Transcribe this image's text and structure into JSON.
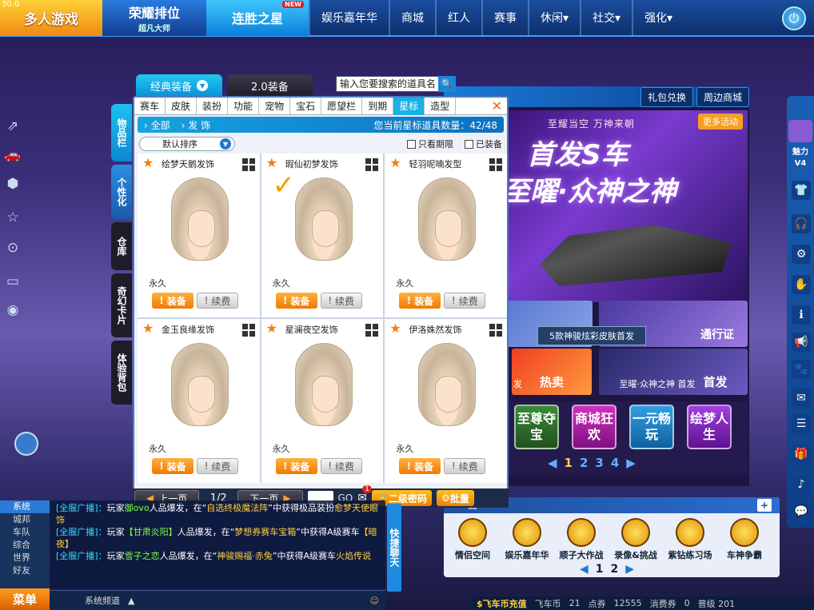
{
  "fps": "30.0",
  "nav": {
    "multi": "多人游戏",
    "rank_title": "荣耀排位",
    "rank_sub": "超凡大师",
    "streak": "连胜之星",
    "new_badge": "NEW",
    "items": [
      "娱乐嘉年华",
      "商城",
      "红人",
      "赛事",
      "休闲▾",
      "社交▾",
      "强化▾"
    ]
  },
  "panel_tabs": [
    "经典装备",
    "2.0装备"
  ],
  "search": {
    "placeholder": "输入您要搜索的道具名"
  },
  "categories": [
    "赛车",
    "皮肤",
    "装扮",
    "功能",
    "宠物",
    "宝石",
    "愿望栏",
    "到期",
    "星标",
    "造型"
  ],
  "active_category": "星标",
  "breadcrumb": {
    "all": "全部",
    "sub": "发 饰",
    "count_label": "您当前星标道具数量：42/48"
  },
  "sort": {
    "label": "默认排序",
    "filter1": "只看期限",
    "filter2": "已装备"
  },
  "items": [
    {
      "name": "绘梦天鹅发饰",
      "duration": "永久",
      "equip": "装备",
      "renew": "续费"
    },
    {
      "name": "瑕仙初梦发饰",
      "duration": "永久",
      "equip": "装备",
      "renew": "续费"
    },
    {
      "name": "轻羽呢喃发型",
      "duration": "永久",
      "equip": "装备",
      "renew": "续费"
    },
    {
      "name": "金玉良缘发饰",
      "duration": "永久",
      "equip": "装备",
      "renew": "续费"
    },
    {
      "name": "星澜夜空发饰",
      "duration": "永久",
      "equip": "装备",
      "renew": "续费"
    },
    {
      "name": "伊洛姝然发饰",
      "duration": "永久",
      "equip": "装备",
      "renew": "续费"
    }
  ],
  "side_tabs": [
    "物品栏",
    "个性化",
    "仓库",
    "奇幻卡片",
    "体验背包"
  ],
  "pager": {
    "prev": "上一页",
    "page": "1/2",
    "next": "下一页",
    "go": "GO",
    "password": "二级密码",
    "batch": "批量",
    "mail_count": "1"
  },
  "promo": {
    "gift_exchange": "礼包兑换",
    "nearby_shop": "周边商城",
    "banner_sub": "至耀当空 万神来朝",
    "banner_title": "首发S车",
    "banner_title2": "至曜·众神之神",
    "more": "更多活动",
    "pass": "通行证",
    "tooltip": "5款神骏炫彩皮肤首发",
    "hot": "热卖",
    "hot_left": "发",
    "car_caption": "至曜·众神之神 首发",
    "first": "首发",
    "squares": [
      "至尊夺宝",
      "商城狂欢",
      "一元畅玩",
      "绘梦人生"
    ],
    "pages": [
      "1",
      "2",
      "3",
      "4"
    ]
  },
  "quick": {
    "title": "面",
    "items": [
      "情侣空间",
      "娱乐嘉年华",
      "顺子大作战",
      "录像&挑战",
      "紫钻练习场",
      "车神争霸"
    ],
    "pages": [
      "1",
      "2"
    ]
  },
  "chat": {
    "tabs": [
      "系统",
      "城邦",
      "车队",
      "综合",
      "世界",
      "好友"
    ],
    "lines": [
      [
        "[全服广播]：",
        "玩家",
        "御ovo",
        "人品爆发，在“",
        "自选终极魔法阵",
        "”中获得极品装扮",
        "愈梦天使眼饰"
      ],
      [
        "[全服广播]：",
        "玩家",
        "【甘肃炎阳】",
        "人品爆发，在“",
        "梦想券赛车宝箱",
        "”中获得A级赛车",
        "【暗夜】"
      ],
      [
        "[全服广播]：",
        "玩家",
        "雪子之恋",
        "人品爆发，在“",
        "神骏赐福·赤兔",
        "”中获得A级赛车",
        "火焰传说"
      ]
    ],
    "channel": "系统频道",
    "menu": "菜单",
    "quick_chat": "快捷聊天"
  },
  "status": {
    "recharge": "飞车币充值",
    "coin_label": "飞车币",
    "coin": "21",
    "points_label": "点券",
    "points": "12555",
    "consume_label": "消费券",
    "consume": "0",
    "level": "普级 201"
  },
  "charm": "魅力V4"
}
